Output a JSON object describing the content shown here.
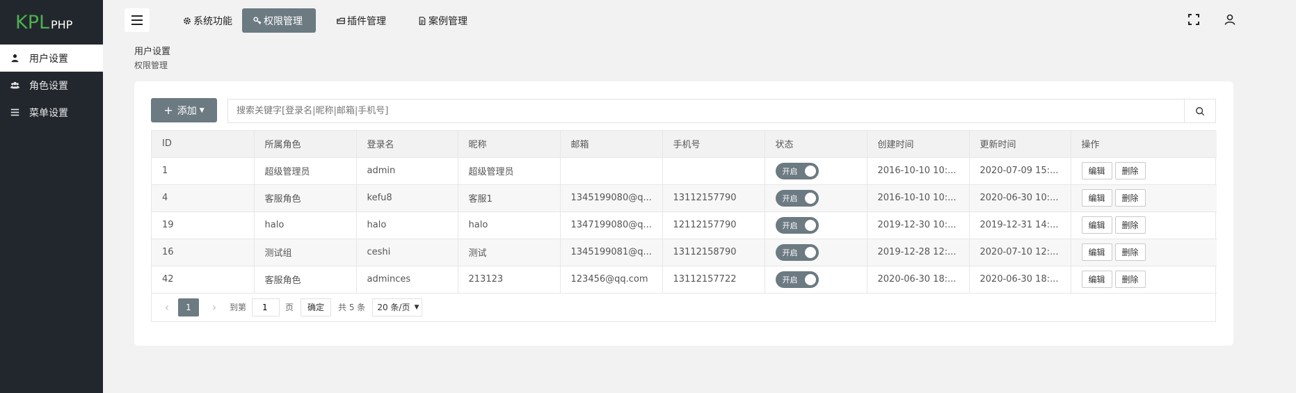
{
  "logo": {
    "main": "KPL",
    "sub": "PHP"
  },
  "sidebar": {
    "items": [
      {
        "label": "用户设置",
        "icon": "user-icon",
        "active": true
      },
      {
        "label": "角色设置",
        "icon": "users-icon",
        "active": false
      },
      {
        "label": "菜单设置",
        "icon": "list-icon",
        "active": false
      }
    ]
  },
  "header": {
    "tabs": [
      {
        "label": "系统功能",
        "icon": "gear-icon"
      },
      {
        "label": "权限管理",
        "icon": "key-icon"
      },
      {
        "label": "插件管理",
        "icon": "plugin-icon"
      },
      {
        "label": "案例管理",
        "icon": "file-icon"
      }
    ],
    "active_tab": "权限管理"
  },
  "breadcrumb": {
    "level1": "用户设置",
    "level2": "权限管理"
  },
  "toolbar": {
    "add_label": "添加",
    "search_placeholder": "搜索关键字[登录名|昵称|邮箱|手机号]"
  },
  "table": {
    "columns": [
      "ID",
      "所属角色",
      "登录名",
      "昵称",
      "邮箱",
      "手机号",
      "状态",
      "创建时间",
      "更新时间",
      "操作"
    ],
    "rows": [
      {
        "id": "1",
        "role": "超级管理员",
        "login": "admin",
        "nick": "超级管理员",
        "email": "",
        "phone": "",
        "status": "开启",
        "created": "2016-10-10 10:...",
        "updated": "2020-07-09 15:..."
      },
      {
        "id": "4",
        "role": "客服角色",
        "login": "kefu8",
        "nick": "客服1",
        "email": "1345199080@q...",
        "phone": "13112157790",
        "status": "开启",
        "created": "2016-10-10 10:...",
        "updated": "2020-06-30 10:..."
      },
      {
        "id": "19",
        "role": "halo",
        "login": "halo",
        "nick": "halo",
        "email": "1347199080@q...",
        "phone": "12112157790",
        "status": "开启",
        "created": "2019-12-30 10:...",
        "updated": "2019-12-31 14:..."
      },
      {
        "id": "16",
        "role": "测试组",
        "login": "ceshi",
        "nick": "测试",
        "email": "1345199081@q...",
        "phone": "13112158790",
        "status": "开启",
        "created": "2019-12-28 12:...",
        "updated": "2020-07-10 12:..."
      },
      {
        "id": "42",
        "role": "客服角色",
        "login": "admince s",
        "nick": "213123",
        "email": "123456@qq.com",
        "phone": "13112157722",
        "status": "开启",
        "created": "2020-06-30 18:...",
        "updated": "2020-06-30 18:..."
      }
    ],
    "edit_label": "编辑",
    "delete_label": "删除"
  },
  "pager": {
    "current_page": "1",
    "goto_label": "到第",
    "goto_value": "1",
    "page_unit": "页",
    "confirm_label": "确定",
    "total_label": "共 5 条",
    "page_size": "20 条/页"
  },
  "colors": {
    "sidebar_bg": "#22272d",
    "accent": "#6c7a82",
    "logo_green": "#4caf50"
  }
}
